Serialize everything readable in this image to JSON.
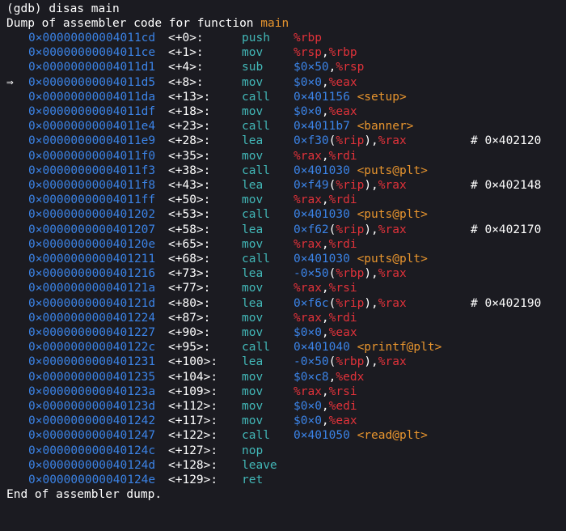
{
  "prompt": "(gdb) disas main",
  "header_prefix": "Dump of assembler code for function ",
  "function_name": "main",
  "footer": "End of assembler dump.",
  "current_marker": "⇒",
  "colors": {
    "background": "#1b1b21",
    "address": "#3b83e6",
    "mnemonic": "#42b8b8",
    "register": "#e0323a",
    "symbol": "#e8952e",
    "text": "#ffffff"
  },
  "instructions": [
    {
      "addr": "0×00000000004011cd",
      "off": "<+0>:",
      "mn": "push",
      "ops": [
        {
          "t": "%rbp",
          "c": "reg"
        }
      ],
      "cmt": ""
    },
    {
      "addr": "0×00000000004011ce",
      "off": "<+1>:",
      "mn": "mov",
      "ops": [
        {
          "t": "%rsp",
          "c": "reg"
        },
        {
          "t": ",",
          "c": "pun"
        },
        {
          "t": "%rbp",
          "c": "reg"
        }
      ],
      "cmt": ""
    },
    {
      "addr": "0×00000000004011d1",
      "off": "<+4>:",
      "mn": "sub",
      "ops": [
        {
          "t": "$0×50",
          "c": "imm"
        },
        {
          "t": ",",
          "c": "pun"
        },
        {
          "t": "%rsp",
          "c": "reg"
        }
      ],
      "cmt": ""
    },
    {
      "addr": "0×00000000004011d5",
      "off": "<+8>:",
      "mn": "mov",
      "ops": [
        {
          "t": "$0×0",
          "c": "imm"
        },
        {
          "t": ",",
          "c": "pun"
        },
        {
          "t": "%eax",
          "c": "reg"
        }
      ],
      "cmt": "",
      "current": true
    },
    {
      "addr": "0×00000000004011da",
      "off": "<+13>:",
      "mn": "call",
      "ops": [
        {
          "t": "0×401156 ",
          "c": "imm"
        },
        {
          "t": "<setup>",
          "c": "sym"
        }
      ],
      "cmt": ""
    },
    {
      "addr": "0×00000000004011df",
      "off": "<+18>:",
      "mn": "mov",
      "ops": [
        {
          "t": "$0×0",
          "c": "imm"
        },
        {
          "t": ",",
          "c": "pun"
        },
        {
          "t": "%eax",
          "c": "reg"
        }
      ],
      "cmt": ""
    },
    {
      "addr": "0×00000000004011e4",
      "off": "<+23>:",
      "mn": "call",
      "ops": [
        {
          "t": "0×4011b7 ",
          "c": "imm"
        },
        {
          "t": "<banner>",
          "c": "sym"
        }
      ],
      "cmt": ""
    },
    {
      "addr": "0×00000000004011e9",
      "off": "<+28>:",
      "mn": "lea",
      "ops": [
        {
          "t": "0×f30",
          "c": "imm"
        },
        {
          "t": "(",
          "c": "pun"
        },
        {
          "t": "%rip",
          "c": "reg"
        },
        {
          "t": "),",
          "c": "pun"
        },
        {
          "t": "%rax",
          "c": "reg"
        }
      ],
      "cmt": "# 0×402120"
    },
    {
      "addr": "0×00000000004011f0",
      "off": "<+35>:",
      "mn": "mov",
      "ops": [
        {
          "t": "%rax",
          "c": "reg"
        },
        {
          "t": ",",
          "c": "pun"
        },
        {
          "t": "%rdi",
          "c": "reg"
        }
      ],
      "cmt": ""
    },
    {
      "addr": "0×00000000004011f3",
      "off": "<+38>:",
      "mn": "call",
      "ops": [
        {
          "t": "0×401030 ",
          "c": "imm"
        },
        {
          "t": "<puts@plt>",
          "c": "sym"
        }
      ],
      "cmt": ""
    },
    {
      "addr": "0×00000000004011f8",
      "off": "<+43>:",
      "mn": "lea",
      "ops": [
        {
          "t": "0×f49",
          "c": "imm"
        },
        {
          "t": "(",
          "c": "pun"
        },
        {
          "t": "%rip",
          "c": "reg"
        },
        {
          "t": "),",
          "c": "pun"
        },
        {
          "t": "%rax",
          "c": "reg"
        }
      ],
      "cmt": "# 0×402148"
    },
    {
      "addr": "0×00000000004011ff",
      "off": "<+50>:",
      "mn": "mov",
      "ops": [
        {
          "t": "%rax",
          "c": "reg"
        },
        {
          "t": ",",
          "c": "pun"
        },
        {
          "t": "%rdi",
          "c": "reg"
        }
      ],
      "cmt": ""
    },
    {
      "addr": "0×0000000000401202",
      "off": "<+53>:",
      "mn": "call",
      "ops": [
        {
          "t": "0×401030 ",
          "c": "imm"
        },
        {
          "t": "<puts@plt>",
          "c": "sym"
        }
      ],
      "cmt": ""
    },
    {
      "addr": "0×0000000000401207",
      "off": "<+58>:",
      "mn": "lea",
      "ops": [
        {
          "t": "0×f62",
          "c": "imm"
        },
        {
          "t": "(",
          "c": "pun"
        },
        {
          "t": "%rip",
          "c": "reg"
        },
        {
          "t": "),",
          "c": "pun"
        },
        {
          "t": "%rax",
          "c": "reg"
        }
      ],
      "cmt": "# 0×402170"
    },
    {
      "addr": "0×000000000040120e",
      "off": "<+65>:",
      "mn": "mov",
      "ops": [
        {
          "t": "%rax",
          "c": "reg"
        },
        {
          "t": ",",
          "c": "pun"
        },
        {
          "t": "%rdi",
          "c": "reg"
        }
      ],
      "cmt": ""
    },
    {
      "addr": "0×0000000000401211",
      "off": "<+68>:",
      "mn": "call",
      "ops": [
        {
          "t": "0×401030 ",
          "c": "imm"
        },
        {
          "t": "<puts@plt>",
          "c": "sym"
        }
      ],
      "cmt": ""
    },
    {
      "addr": "0×0000000000401216",
      "off": "<+73>:",
      "mn": "lea",
      "ops": [
        {
          "t": "-0×50",
          "c": "imm"
        },
        {
          "t": "(",
          "c": "pun"
        },
        {
          "t": "%rbp",
          "c": "reg"
        },
        {
          "t": "),",
          "c": "pun"
        },
        {
          "t": "%rax",
          "c": "reg"
        }
      ],
      "cmt": ""
    },
    {
      "addr": "0×000000000040121a",
      "off": "<+77>:",
      "mn": "mov",
      "ops": [
        {
          "t": "%rax",
          "c": "reg"
        },
        {
          "t": ",",
          "c": "pun"
        },
        {
          "t": "%rsi",
          "c": "reg"
        }
      ],
      "cmt": ""
    },
    {
      "addr": "0×000000000040121d",
      "off": "<+80>:",
      "mn": "lea",
      "ops": [
        {
          "t": "0×f6c",
          "c": "imm"
        },
        {
          "t": "(",
          "c": "pun"
        },
        {
          "t": "%rip",
          "c": "reg"
        },
        {
          "t": "),",
          "c": "pun"
        },
        {
          "t": "%rax",
          "c": "reg"
        }
      ],
      "cmt": "# 0×402190"
    },
    {
      "addr": "0×0000000000401224",
      "off": "<+87>:",
      "mn": "mov",
      "ops": [
        {
          "t": "%rax",
          "c": "reg"
        },
        {
          "t": ",",
          "c": "pun"
        },
        {
          "t": "%rdi",
          "c": "reg"
        }
      ],
      "cmt": ""
    },
    {
      "addr": "0×0000000000401227",
      "off": "<+90>:",
      "mn": "mov",
      "ops": [
        {
          "t": "$0×0",
          "c": "imm"
        },
        {
          "t": ",",
          "c": "pun"
        },
        {
          "t": "%eax",
          "c": "reg"
        }
      ],
      "cmt": ""
    },
    {
      "addr": "0×000000000040122c",
      "off": "<+95>:",
      "mn": "call",
      "ops": [
        {
          "t": "0×401040 ",
          "c": "imm"
        },
        {
          "t": "<printf@plt>",
          "c": "sym"
        }
      ],
      "cmt": ""
    },
    {
      "addr": "0×0000000000401231",
      "off": "<+100>:",
      "mn": "lea",
      "ops": [
        {
          "t": "-0×50",
          "c": "imm"
        },
        {
          "t": "(",
          "c": "pun"
        },
        {
          "t": "%rbp",
          "c": "reg"
        },
        {
          "t": "),",
          "c": "pun"
        },
        {
          "t": "%rax",
          "c": "reg"
        }
      ],
      "cmt": ""
    },
    {
      "addr": "0×0000000000401235",
      "off": "<+104>:",
      "mn": "mov",
      "ops": [
        {
          "t": "$0×c8",
          "c": "imm"
        },
        {
          "t": ",",
          "c": "pun"
        },
        {
          "t": "%edx",
          "c": "reg"
        }
      ],
      "cmt": ""
    },
    {
      "addr": "0×000000000040123a",
      "off": "<+109>:",
      "mn": "mov",
      "ops": [
        {
          "t": "%rax",
          "c": "reg"
        },
        {
          "t": ",",
          "c": "pun"
        },
        {
          "t": "%rsi",
          "c": "reg"
        }
      ],
      "cmt": ""
    },
    {
      "addr": "0×000000000040123d",
      "off": "<+112>:",
      "mn": "mov",
      "ops": [
        {
          "t": "$0×0",
          "c": "imm"
        },
        {
          "t": ",",
          "c": "pun"
        },
        {
          "t": "%edi",
          "c": "reg"
        }
      ],
      "cmt": ""
    },
    {
      "addr": "0×0000000000401242",
      "off": "<+117>:",
      "mn": "mov",
      "ops": [
        {
          "t": "$0×0",
          "c": "imm"
        },
        {
          "t": ",",
          "c": "pun"
        },
        {
          "t": "%eax",
          "c": "reg"
        }
      ],
      "cmt": ""
    },
    {
      "addr": "0×0000000000401247",
      "off": "<+122>:",
      "mn": "call",
      "ops": [
        {
          "t": "0×401050 ",
          "c": "imm"
        },
        {
          "t": "<read@plt>",
          "c": "sym"
        }
      ],
      "cmt": ""
    },
    {
      "addr": "0×000000000040124c",
      "off": "<+127>:",
      "mn": "nop",
      "ops": [],
      "cmt": ""
    },
    {
      "addr": "0×000000000040124d",
      "off": "<+128>:",
      "mn": "leave",
      "ops": [],
      "cmt": ""
    },
    {
      "addr": "0×000000000040124e",
      "off": "<+129>:",
      "mn": "ret",
      "ops": [],
      "cmt": ""
    }
  ]
}
